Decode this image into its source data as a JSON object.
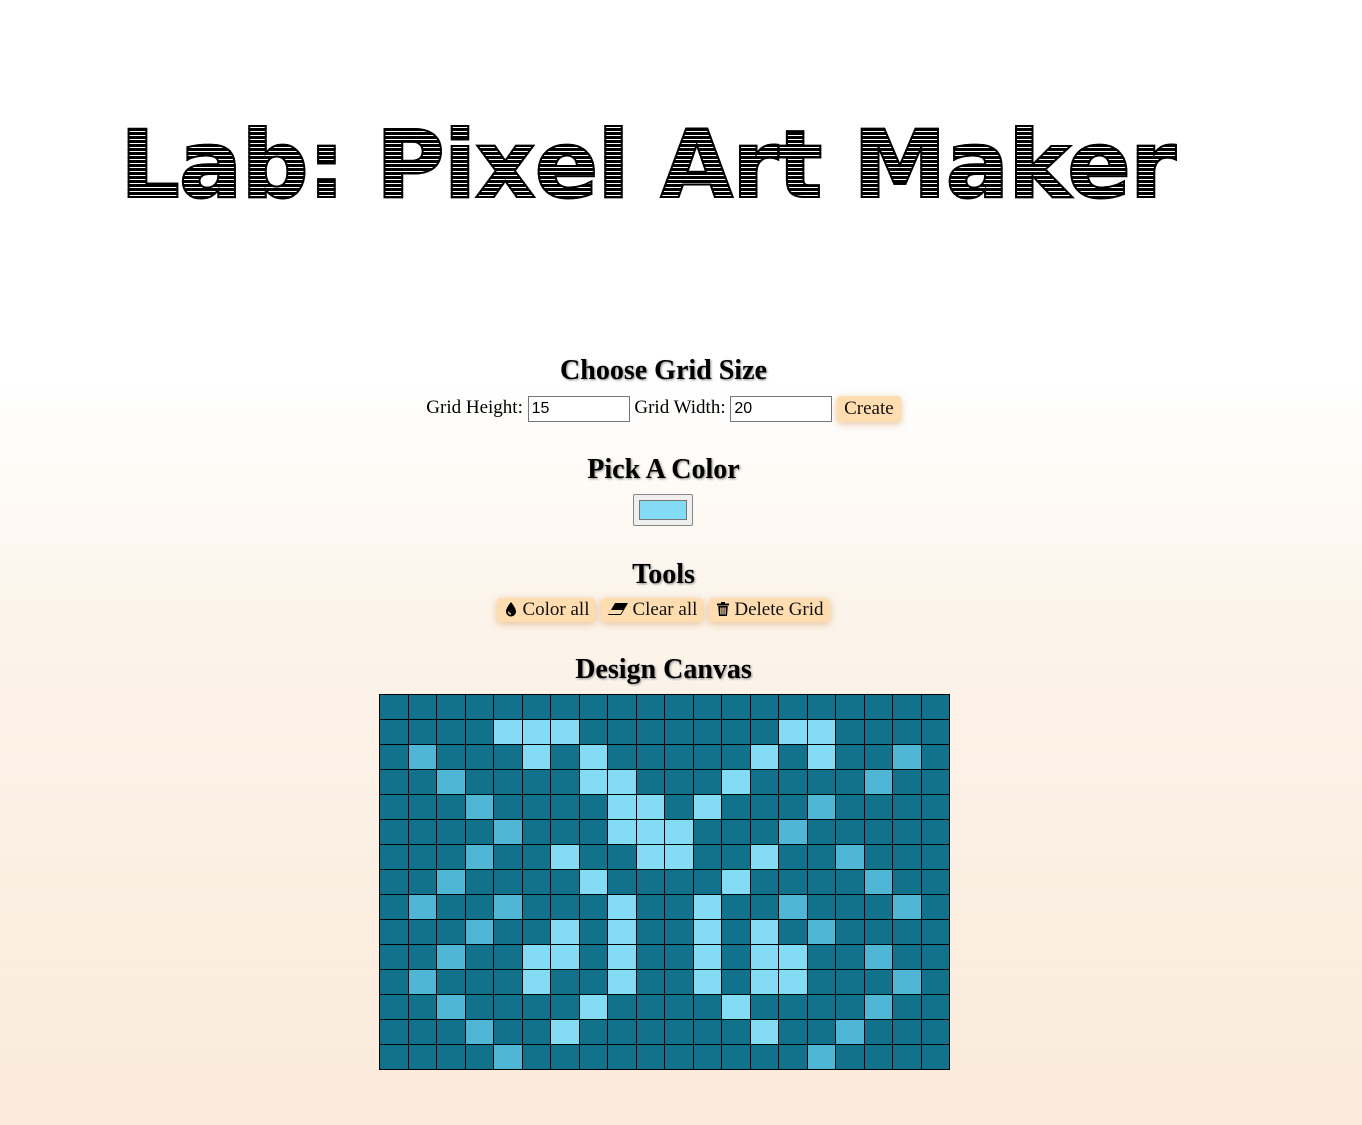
{
  "title": "Lab: Pixel Art Maker",
  "grid_size": {
    "heading": "Choose Grid Size",
    "height_label": "Grid Height:",
    "height_value": "15",
    "width_label": "Grid Width:",
    "width_value": "20",
    "create_label": "Create"
  },
  "color": {
    "heading": "Pick A Color",
    "selected": "#84dcf4"
  },
  "tools": {
    "heading": "Tools",
    "color_all_label": "Color all",
    "color_all_icon": "tint-icon",
    "clear_all_label": "Clear all",
    "clear_all_icon": "eraser-icon",
    "delete_grid_label": "Delete Grid",
    "delete_grid_icon": "trash-icon"
  },
  "canvas": {
    "heading": "Design Canvas",
    "rows": 15,
    "cols": 20,
    "palette": {
      "D": "#13728b",
      "L": "#84dcf4",
      "M": "#50b6d6"
    },
    "pattern": [
      "DDDDDDDDDDDDDDDDDDDD",
      "DDDDLLLDDDDDDDLLDDDD",
      "DMDDDLDLDDDDDLDLDDMD",
      "DDMDDDDLLDDDLDDDDMDD",
      "DDDMDDDDLLDLDDDMDDDD",
      "DDDDMDDDLLLDDDMDDDDD",
      "DDDMDDLDDLLDDLDDMDDD",
      "DDMDDDDLDDDDLDDDDMDD",
      "DMDDMDDDLDDLDDMDDDMD",
      "DDDMDDLDLDDLDLDMDDDD",
      "DDMDDLLDLDDLDLLDDMDD",
      "DMDDDLDDLDDLDLLDDDMD",
      "DDMDDDDLDDDDLDDDDMDD",
      "DDDMDDLDDDDDDLDDMDDD",
      "DDDDMDDDDDDDDDDMDDDD"
    ]
  }
}
